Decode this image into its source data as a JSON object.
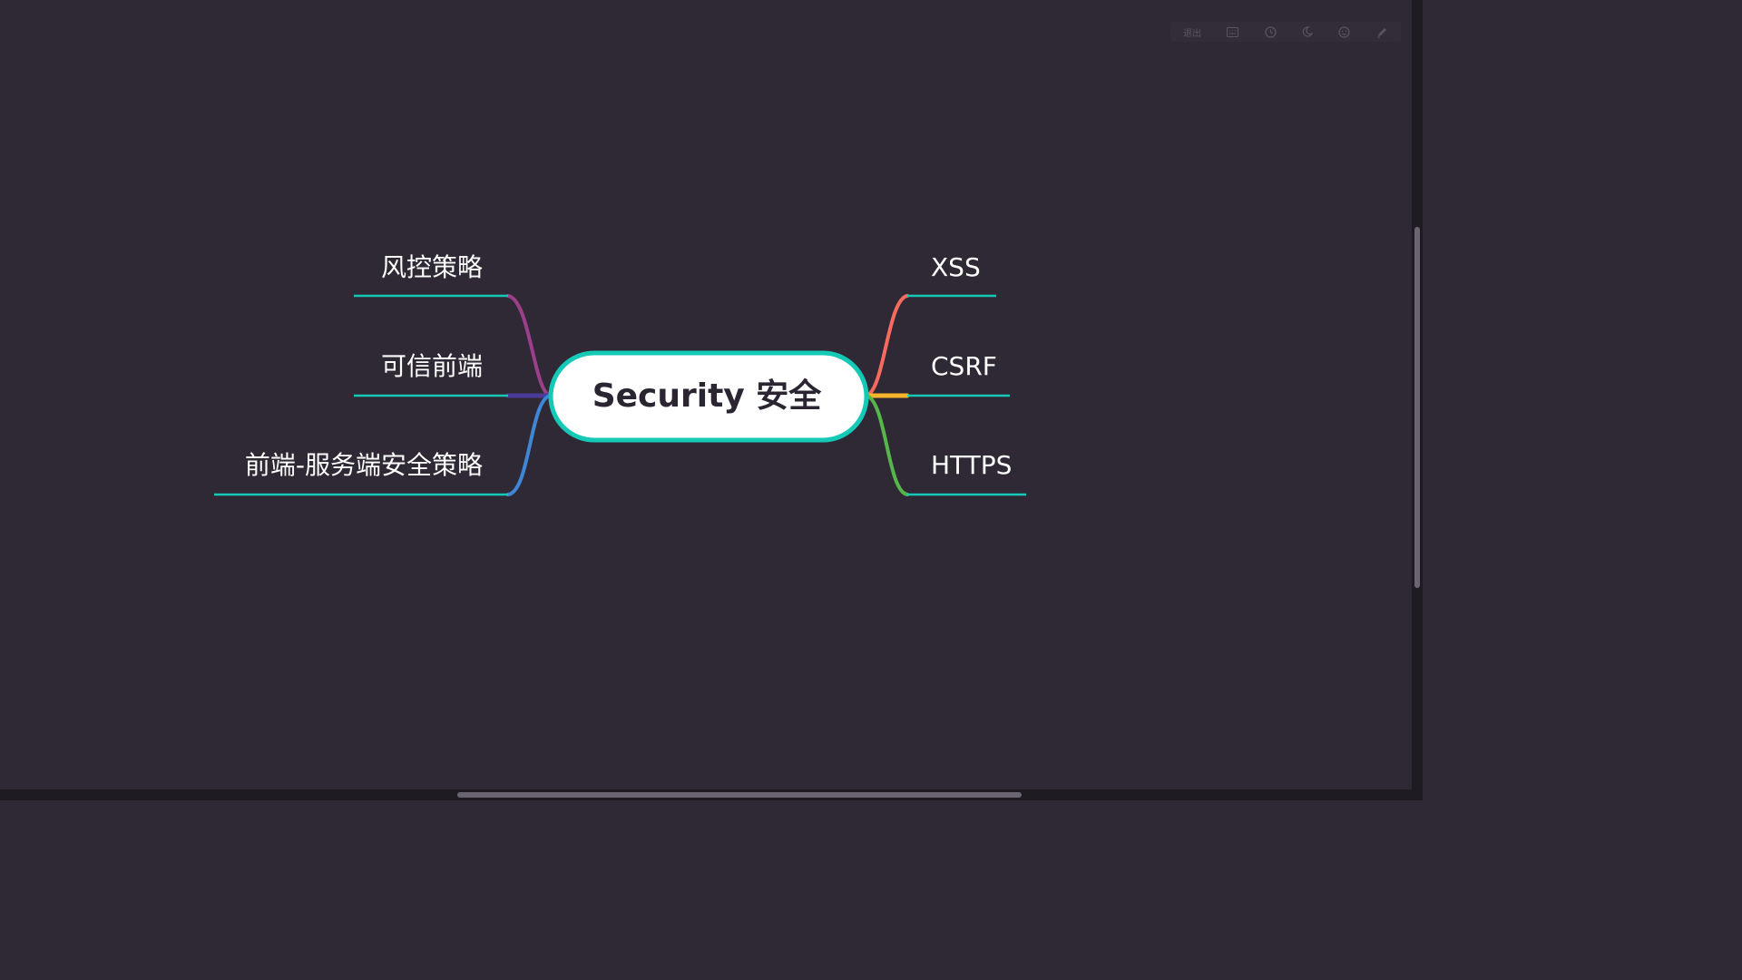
{
  "toolbar": {
    "exit_label": "退出",
    "icons": [
      "keyboard-icon",
      "clock-icon",
      "moon-icon",
      "emoji-icon",
      "pen-icon"
    ]
  },
  "mindmap": {
    "central": {
      "label": "Security 安全",
      "border_color": "#14c9b6",
      "fill_color": "#ffffff"
    },
    "left_branches": [
      {
        "label": "风控策略",
        "color": "#9b3f8b"
      },
      {
        "label": "可信前端",
        "color": "#4a3a9a"
      },
      {
        "label": "前端-服务端安全策略",
        "color": "#3f86d6"
      }
    ],
    "right_branches": [
      {
        "label": "XSS",
        "color": "#f76a5f"
      },
      {
        "label": "CSRF",
        "color": "#f5b42a"
      },
      {
        "label": "HTTPS",
        "color": "#55b64a"
      }
    ],
    "underline_color": "#14c9b6",
    "background": "#2f2935"
  }
}
